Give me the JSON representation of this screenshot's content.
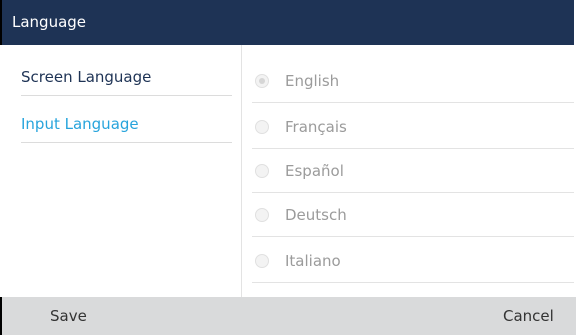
{
  "title": "Language",
  "sidebar": {
    "items": [
      {
        "label": "Screen Language",
        "active": false
      },
      {
        "label": "Input Language",
        "active": true
      }
    ]
  },
  "options": [
    {
      "label": "English",
      "selected": true
    },
    {
      "label": "Français",
      "selected": false
    },
    {
      "label": "Español",
      "selected": false
    },
    {
      "label": "Deutsch",
      "selected": false
    },
    {
      "label": "Italiano",
      "selected": false
    }
  ],
  "softkeys": {
    "left": "Save",
    "right": "Cancel"
  },
  "colors": {
    "title_bg": "#1e3355",
    "active_item": "#27a4dc",
    "softkey_bar": "#d9dadb"
  }
}
